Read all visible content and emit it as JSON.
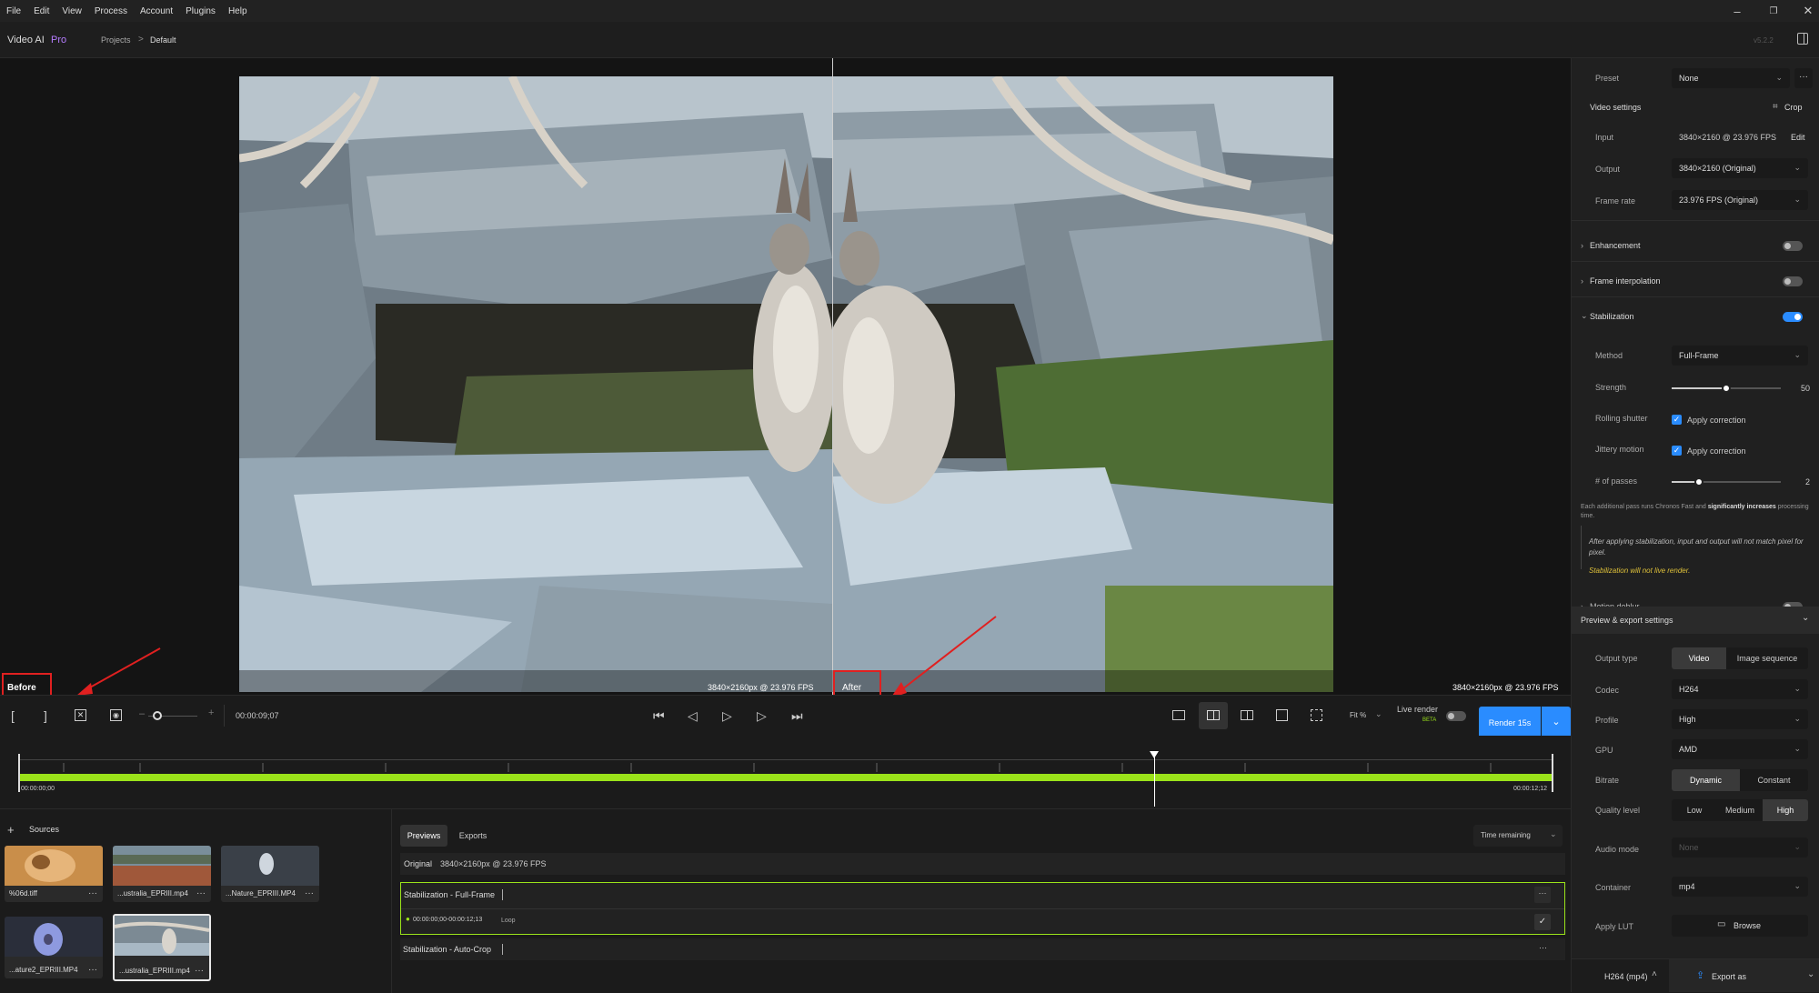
{
  "menu": [
    "File",
    "Edit",
    "View",
    "Process",
    "Account",
    "Plugins",
    "Help"
  ],
  "window_controls": {
    "minimize": "–",
    "restore": "❐",
    "close": "✕"
  },
  "app": {
    "name": "Video AI",
    "edition": "Pro",
    "version": "v5.2.2"
  },
  "breadcrumb": {
    "root": "Projects",
    "separator": ">",
    "current": "Default"
  },
  "viewer": {
    "before_label": "Before",
    "after_label": "After",
    "before_info": "3840×2160px @ 23.976 FPS",
    "after_info": "3840×2160px @ 23.976 FPS"
  },
  "controls": {
    "mark_in": "[",
    "mark_out": "]",
    "timecode": "00:00:09;07",
    "zoom_minus": "–",
    "zoom_plus": "+",
    "fit": "Fit %",
    "live_render": "Live render",
    "beta": "BETA",
    "render_button": "Render 15s"
  },
  "timeline": {
    "start": "00:00:00;00",
    "end": "00:00:12;12",
    "playhead_fraction": 0.74
  },
  "sources": {
    "title": "Sources",
    "items": [
      {
        "name": "%06d.tiff"
      },
      {
        "name": "...ustralia_EPRIII.mp4"
      },
      {
        "name": "...Nature_EPRIII.MP4"
      },
      {
        "name": "...ature2_EPRIII.MP4"
      },
      {
        "name": "...ustralia_EPRIII.mp4"
      }
    ]
  },
  "previews": {
    "tabs": [
      "Previews",
      "Exports"
    ],
    "time_remaining": "Time remaining",
    "original_label": "Original",
    "original_info": "3840×2160px @ 23.976 FPS",
    "items": [
      {
        "title": "Stabilization - Full-Frame",
        "range": "00:00:00;00-00:00:12;13",
        "loop": "Loop"
      },
      {
        "title": "Stabilization - Auto-Crop"
      }
    ]
  },
  "panel": {
    "preset_label": "Preset",
    "preset_value": "None",
    "video_settings": "Video settings",
    "crop": "Crop",
    "input_label": "Input",
    "input_value": "3840×2160 @ 23.976 FPS",
    "edit": "Edit",
    "output_label": "Output",
    "output_value": "3840×2160 (Original)",
    "frame_rate_label": "Frame rate",
    "frame_rate_value": "23.976 FPS (Original)",
    "enhancement": "Enhancement",
    "frame_interpolation": "Frame interpolation",
    "stabilization": "Stabilization",
    "method_label": "Method",
    "method_value": "Full-Frame",
    "strength_label": "Strength",
    "strength_value": "50",
    "rolling_shutter_label": "Rolling shutter",
    "apply_correction": "Apply correction",
    "jittery_motion_label": "Jittery motion",
    "passes_label": "# of passes",
    "passes_value": "2",
    "passes_note_a": "Each additional pass runs Chronos Fast and ",
    "passes_note_b": "significantly increases",
    "passes_note_c": " processing time.",
    "stab_note": "After applying stabilization, input and output will not match pixel for pixel.",
    "stab_warning": "Stabilization will not live render.",
    "motion_deblur": "Motion deblur",
    "preview_export": "Preview & export settings",
    "output_type_label": "Output type",
    "output_type_options": [
      "Video",
      "Image sequence"
    ],
    "codec_label": "Codec",
    "codec_value": "H264",
    "profile_label": "Profile",
    "profile_value": "High",
    "gpu_label": "GPU",
    "gpu_value": "AMD",
    "bitrate_label": "Bitrate",
    "bitrate_options": [
      "Dynamic",
      "Constant"
    ],
    "quality_label": "Quality level",
    "quality_options": [
      "Low",
      "Medium",
      "High"
    ],
    "audio_label": "Audio mode",
    "audio_value": "None",
    "container_label": "Container",
    "container_value": "mp4",
    "lut_label": "Apply LUT",
    "browse": "Browse",
    "footer_format": "H264 (mp4)",
    "export_as": "Export as"
  },
  "colors": {
    "accent": "#2a8cff",
    "timeline": "#9be31a",
    "highlight": "#e02020",
    "pro": "#b57cff"
  }
}
